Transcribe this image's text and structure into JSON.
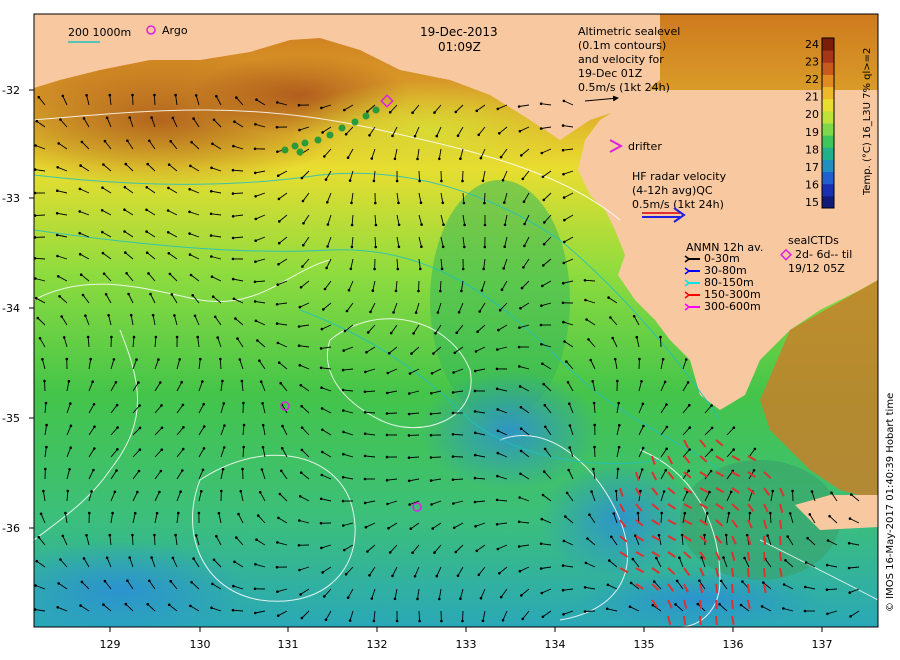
{
  "header": {
    "date": "19-Dec-2013",
    "time": "01:09Z"
  },
  "top_legend": {
    "isobath_label": "200  1000m",
    "argo_label": "Argo"
  },
  "altimetry_legend": {
    "lines": [
      "Altimetric sealevel",
      "(0.1m contours)",
      "and velocity for",
      "19-Dec 01Z",
      "0.5m/s (1kt 24h)"
    ]
  },
  "drifter_legend": {
    "label": "drifter"
  },
  "hf_radar_legend": {
    "lines": [
      "HF radar velocity",
      "(4-12h avg)QC",
      "0.5m/s (1kt 24h)"
    ]
  },
  "anmn_legend": {
    "title": "ANMN 12h av.",
    "items": [
      {
        "label": "0-30m",
        "color": "#000000"
      },
      {
        "label": "30-80m",
        "color": "#0000ff"
      },
      {
        "label": "80-150m",
        "color": "#00e5e5"
      },
      {
        "label": "150-300m",
        "color": "#ff0000"
      },
      {
        "label": "300-600m",
        "color": "#ff00ff"
      }
    ]
  },
  "sealctd_legend": {
    "lines": [
      "sealCTDs",
      "2d- 6d-- til",
      "19/12 05Z"
    ]
  },
  "colorbar": {
    "title": "Temp. (°C) 16_L3U 7% ql>=2",
    "ticks": [
      "24",
      "23",
      "22",
      "21",
      "20",
      "19",
      "18",
      "17",
      "16",
      "15"
    ],
    "colors": [
      "#7a1e0a",
      "#a6361a",
      "#c85a1e",
      "#e08a22",
      "#efb82a",
      "#e9dd30",
      "#bfe23a",
      "#7fd84a",
      "#3fc65a",
      "#22b08a",
      "#1f8fc0",
      "#1f5fd0",
      "#1a2fb0",
      "#121a78"
    ]
  },
  "axes": {
    "x_ticks": [
      "129",
      "130",
      "131",
      "132",
      "133",
      "134",
      "135",
      "136",
      "137"
    ],
    "y_ticks": [
      "-32",
      "-33",
      "-34",
      "-35",
      "-36"
    ]
  },
  "credit": "© IMOS 16-May-2017 01:40:39 Hobart time",
  "colors": {
    "land": "#f8c8a0",
    "contour": "#ffffff",
    "isobath": "#20c0c0",
    "argo": "#e020e0",
    "hf_radar": "#e03030"
  }
}
